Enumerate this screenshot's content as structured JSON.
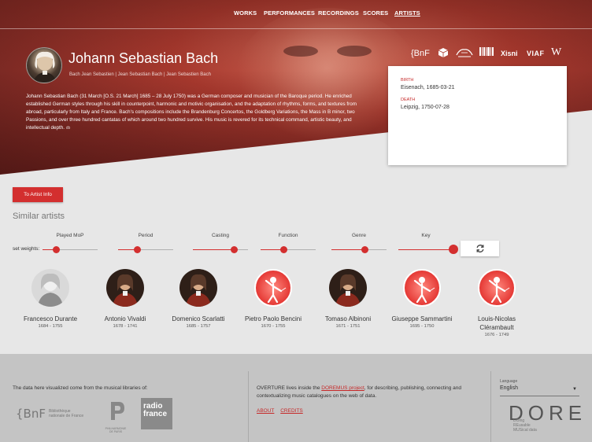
{
  "nav": {
    "items": [
      "WORKS",
      "PERFORMANCES",
      "RECORDINGS",
      "SCORES",
      "ARTISTS"
    ],
    "active": "ARTISTS"
  },
  "artist": {
    "name": "Johann Sebastian Bach",
    "aliases": "Bach Jean Sebastien | Jean Sebastian Bach | Jean Sebastien Bach",
    "bio": "Johann Sebastian Bach (31 March [O.S. 21 March] 1685 – 28 July 1750) was a German composer and musician of the Baroque period. He enriched established German styles through his skill in counterpoint, harmonic and motivic organisation, and the adaptation of rhythms, forms, and textures from abroad, particularly from Italy and France. Bach's compositions include the Brandenburg Concertos, the Goldberg Variations, the Mass in B minor, two Passions, and over three hundred cantatas of which around two hundred survive. His music is revered for its technical command, artistic beauty, and intellectual depth.",
    "bio_link": "db",
    "birth_label": "BIRTH",
    "birth_value": "Eisenach, 1685-03-21",
    "death_label": "DEATH",
    "death_value": "Leipzig, 1750-07-28"
  },
  "sources": {
    "bnf": "{BnF",
    "isni": "Xisni",
    "viaf": "VIAF",
    "wiki": "W"
  },
  "to_artist_button": "To Artist Info",
  "similar": {
    "title": "Similar artists",
    "weights_label": "set weights:",
    "sliders": [
      {
        "label": "Played MoP",
        "value": 0.25
      },
      {
        "label": "Period",
        "value": 0.35
      },
      {
        "label": "Casting",
        "value": 0.75
      },
      {
        "label": "Function",
        "value": 0.42
      },
      {
        "label": "Genre",
        "value": 0.6
      },
      {
        "label": "Key",
        "value": 1.0
      }
    ],
    "artists": [
      {
        "name": "Francesco Durante",
        "dates": "1684 - 1755",
        "portrait": "engraving"
      },
      {
        "name": "Antonio Vivaldi",
        "dates": "1678 - 1741",
        "portrait": "painting"
      },
      {
        "name": "Domenico Scarlatti",
        "dates": "1685 - 1757",
        "portrait": "painting"
      },
      {
        "name": "Pietro Paolo Bencini",
        "dates": "1670 - 1755",
        "portrait": "placeholder"
      },
      {
        "name": "Tomaso Albinoni",
        "dates": "1671 - 1751",
        "portrait": "painting"
      },
      {
        "name": "Giuseppe Sammartini",
        "dates": "1695 - 1750",
        "portrait": "placeholder"
      },
      {
        "name": "Louis-Nicolas Clérambault",
        "dates": "1676 - 1749",
        "portrait": "placeholder"
      }
    ]
  },
  "footer": {
    "libraries_text": "The data here visualized come from the musical libraries of:",
    "bnf_logo": "{BnF",
    "bnf_text_1": "Bibliothèque",
    "bnf_text_2": "nationale de France",
    "pp_text": "PHILHARMONIE DE PARIS",
    "rf_line1": "radio",
    "rf_line2": "france",
    "overture_pre": "OVERTURE lives inside the ",
    "overture_link": "DOREMUS project",
    "overture_post": ", for describing, publishing, connecting and contextualizing music catalogues on the web of data.",
    "about": "ABOUT",
    "credits": "CREDITS",
    "language_label": "Language",
    "language_value": "English",
    "doremus_letters": "DORE",
    "doremus_tag_1": "DOing",
    "doremus_tag_2": "REusable",
    "doremus_tag_3": "MUSical data"
  },
  "colors": {
    "accent": "#d32f2f",
    "hero": "#a8392e",
    "footer": "#c4c4c4"
  }
}
